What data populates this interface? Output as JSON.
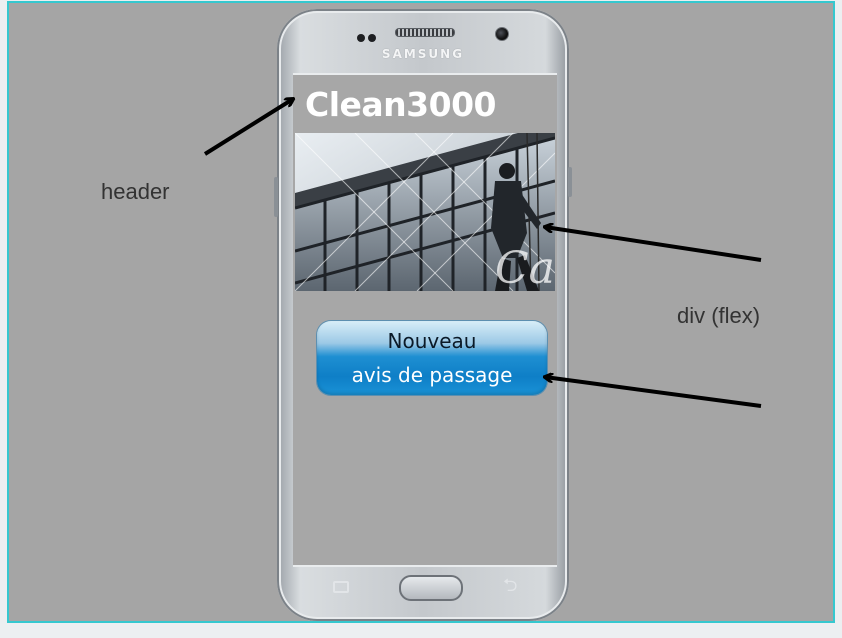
{
  "phone": {
    "brand": "SAMSUNG"
  },
  "app": {
    "header_title": "Clean3000",
    "action_button": {
      "line1": "Nouveau",
      "line2": "avis de passage"
    }
  },
  "annotations": {
    "header": "header",
    "div_flex": "div (flex)"
  },
  "colors": {
    "canvas_background": "#a5a5a5",
    "canvas_border": "#35c8cf",
    "button_blue": "#0e7fc7",
    "arrow": "#000000"
  },
  "icons": [
    "recent-apps-icon",
    "home-key",
    "back-icon"
  ]
}
